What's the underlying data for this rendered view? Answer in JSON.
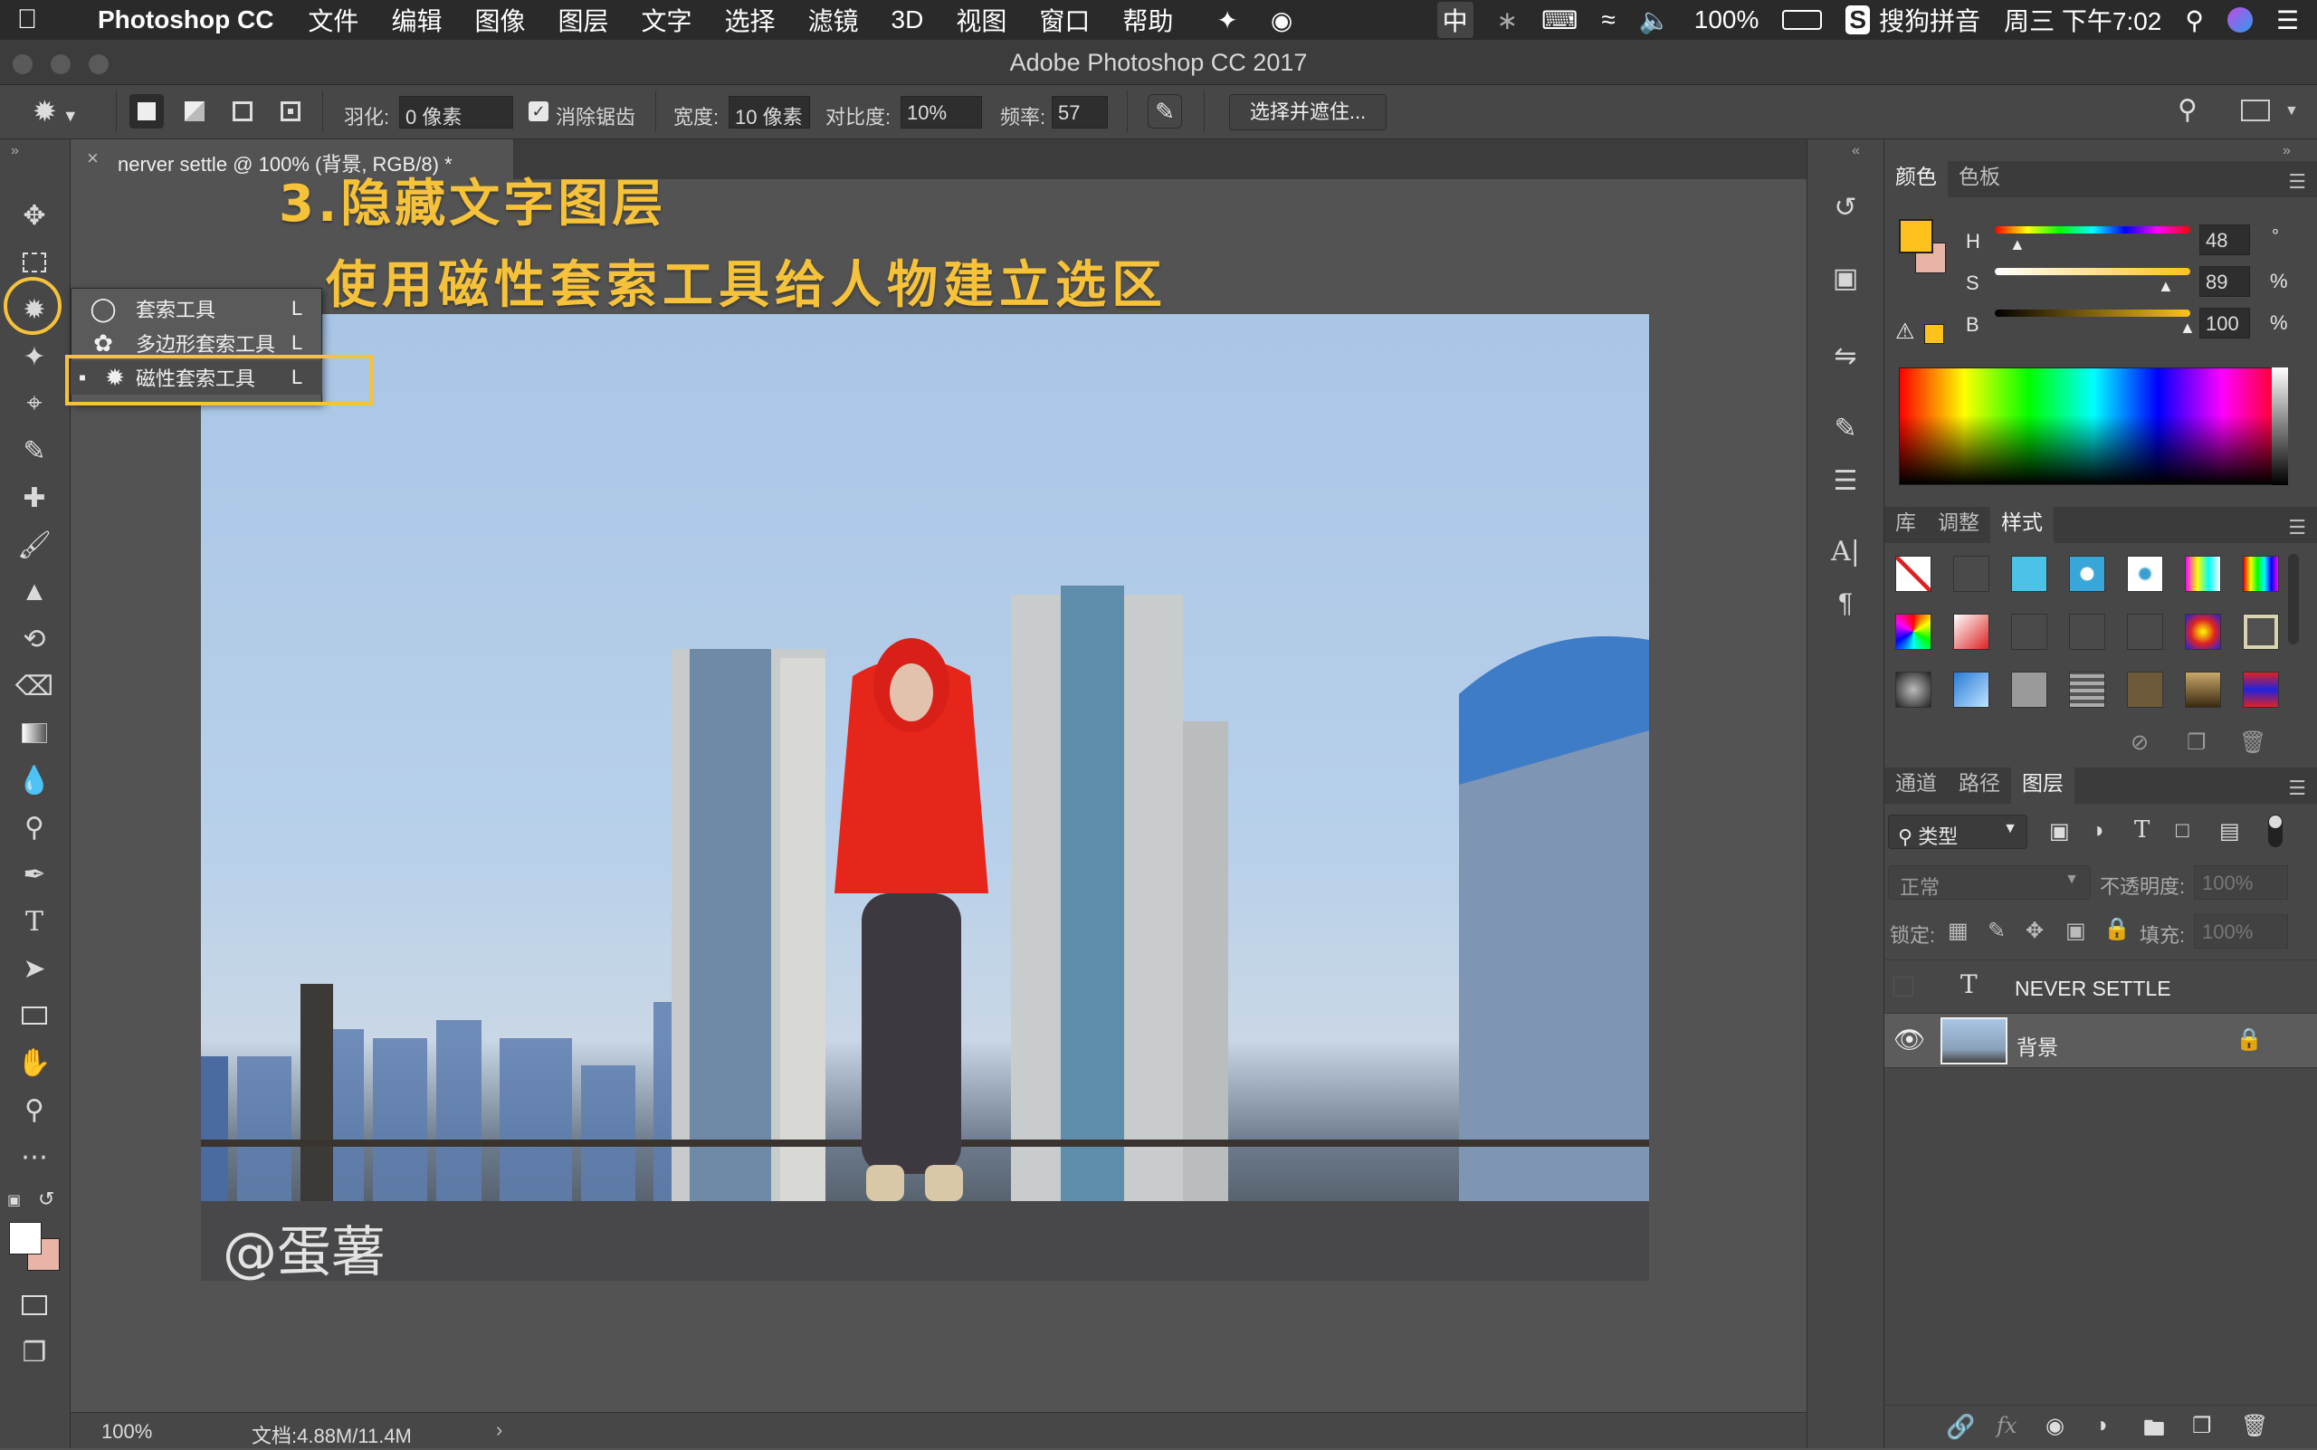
{
  "menubar": {
    "app_name": "Photoshop CC",
    "items": [
      "文件",
      "编辑",
      "图像",
      "图层",
      "文字",
      "选择",
      "滤镜",
      "3D",
      "视图",
      "窗口",
      "帮助"
    ],
    "status": {
      "input_method_icon": "中",
      "battery": "100%",
      "ime_name": "搜狗拼音",
      "datetime": "周三 下午7:02"
    }
  },
  "window": {
    "title": "Adobe Photoshop CC 2017"
  },
  "options": {
    "feather_label": "羽化:",
    "feather_value": "0 像素",
    "antialias_label": "消除锯齿",
    "width_label": "宽度:",
    "width_value": "10 像素",
    "contrast_label": "对比度:",
    "contrast_value": "10%",
    "frequency_label": "频率:",
    "frequency_value": "57",
    "select_mask_button": "选择并遮住..."
  },
  "document": {
    "tab_title": "nerver settle @ 100% (背景, RGB/8) *",
    "zoom": "100%",
    "doc_info": "文档:4.88M/11.4M",
    "watermark": "@蛋薯"
  },
  "annotation": {
    "line1": "3.隐藏文字图层",
    "line2": "使用磁性套索工具给人物建立选区"
  },
  "flyout": {
    "items": [
      {
        "label": "套索工具",
        "shortcut": "L"
      },
      {
        "label": "多边形套索工具",
        "shortcut": "L"
      },
      {
        "label": "磁性套索工具",
        "shortcut": "L"
      }
    ]
  },
  "color_panel": {
    "tabs": [
      "颜色",
      "色板"
    ],
    "h_label": "H",
    "h_value": "48",
    "h_unit": "°",
    "s_label": "S",
    "s_value": "89",
    "s_unit": "%",
    "b_label": "B",
    "b_value": "100",
    "b_unit": "%",
    "foreground": "#ffc21c",
    "background": "#e8b4a8"
  },
  "styles_panel": {
    "tabs": [
      "库",
      "调整",
      "样式"
    ]
  },
  "layers_panel": {
    "tabs": [
      "通道",
      "路径",
      "图层"
    ],
    "filter_label": "类型",
    "blend_mode": "正常",
    "opacity_label": "不透明度:",
    "opacity_value": "100%",
    "lock_label": "锁定:",
    "fill_label": "填充:",
    "fill_value": "100%",
    "layers": [
      {
        "name": "NEVER SETTLE",
        "type": "text",
        "visible": false
      },
      {
        "name": "背景",
        "type": "image",
        "visible": true,
        "locked": true
      }
    ]
  },
  "colors": {
    "accent": "#f6c23a",
    "panel": "#474747",
    "canvas": "#535353"
  }
}
